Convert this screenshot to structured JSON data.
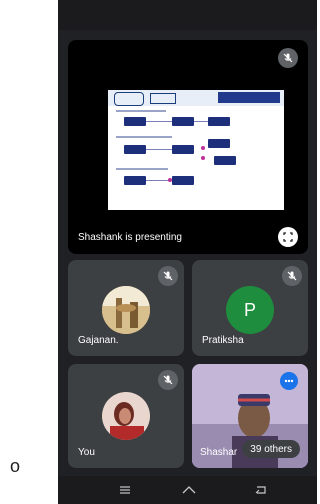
{
  "side_char": "o",
  "presentation": {
    "label": "Shashank is presenting"
  },
  "participants": [
    {
      "name": "Gajanan.",
      "avatar_type": "photo"
    },
    {
      "name": "Pratiksha",
      "avatar_letter": "P",
      "avatar_color": "#1e8e3e"
    },
    {
      "name": "You",
      "avatar_type": "photo"
    },
    {
      "name": "Shashar",
      "avatar_type": "video"
    }
  ],
  "others_count_label": "39 others",
  "colors": {
    "background": "#202124",
    "tile": "#3c4043",
    "accent": "#1a73e8"
  },
  "nav_icons": [
    "menu-icon",
    "home-icon",
    "back-icon"
  ]
}
